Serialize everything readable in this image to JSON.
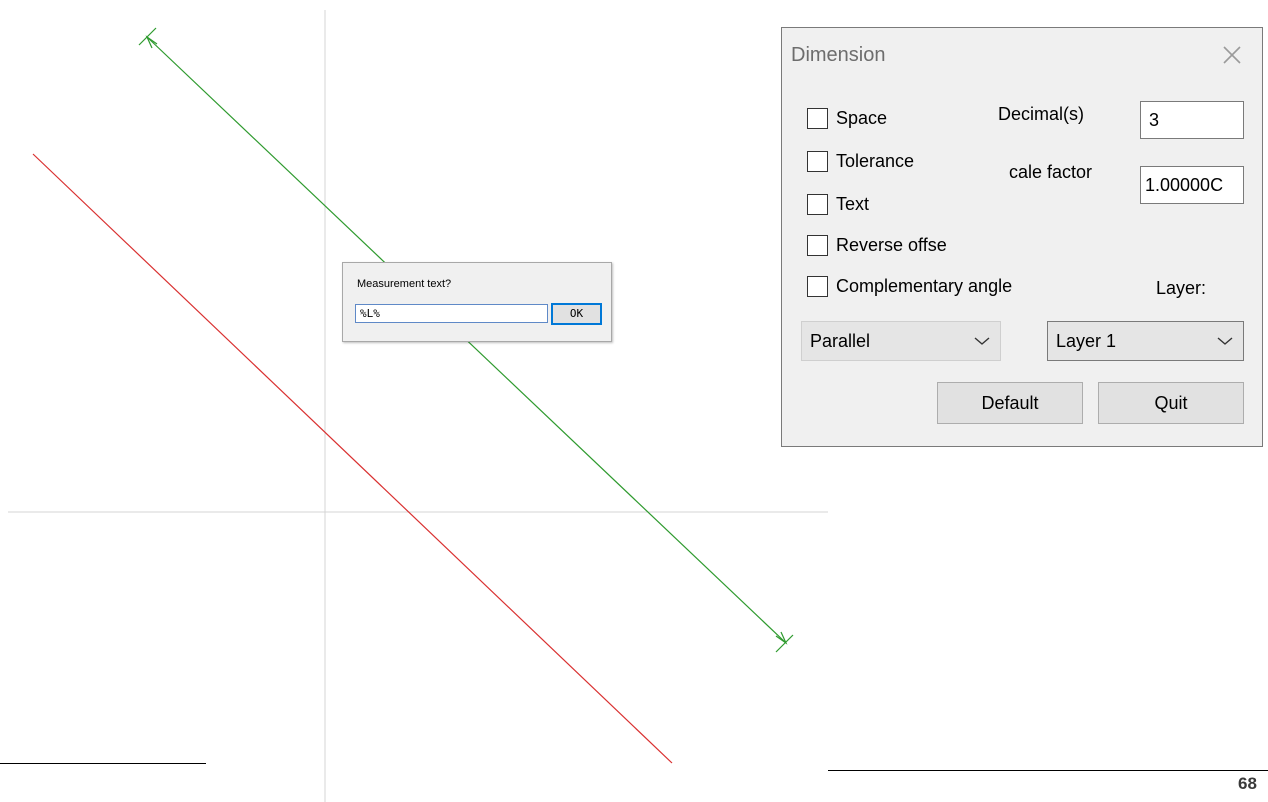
{
  "prompt": {
    "label": "Measurement text?",
    "value": "%L%",
    "ok_label": "OK"
  },
  "dimension_dialog": {
    "title": "Dimension",
    "close_icon": "close-x-icon",
    "checkboxes": [
      {
        "label": "Space",
        "checked": false
      },
      {
        "label": "Tolerance",
        "checked": false
      },
      {
        "label": "Text",
        "checked": false
      },
      {
        "label": "Reverse offse",
        "checked": false
      },
      {
        "label": "Complementary angle",
        "checked": false
      }
    ],
    "decimals_label": "Decimal(s)",
    "decimals_value": "3",
    "scale_label": "cale factor",
    "scale_value": "1.00000C",
    "layer_label": "Layer:",
    "type_select": "Parallel",
    "layer_select": "Layer 1",
    "default_button": "Default",
    "quit_button": "Quit"
  },
  "page_number": "68",
  "colors": {
    "dimension_line": "#2e9a2e",
    "red_line": "#d93030",
    "axis": "#d4d4d4"
  }
}
